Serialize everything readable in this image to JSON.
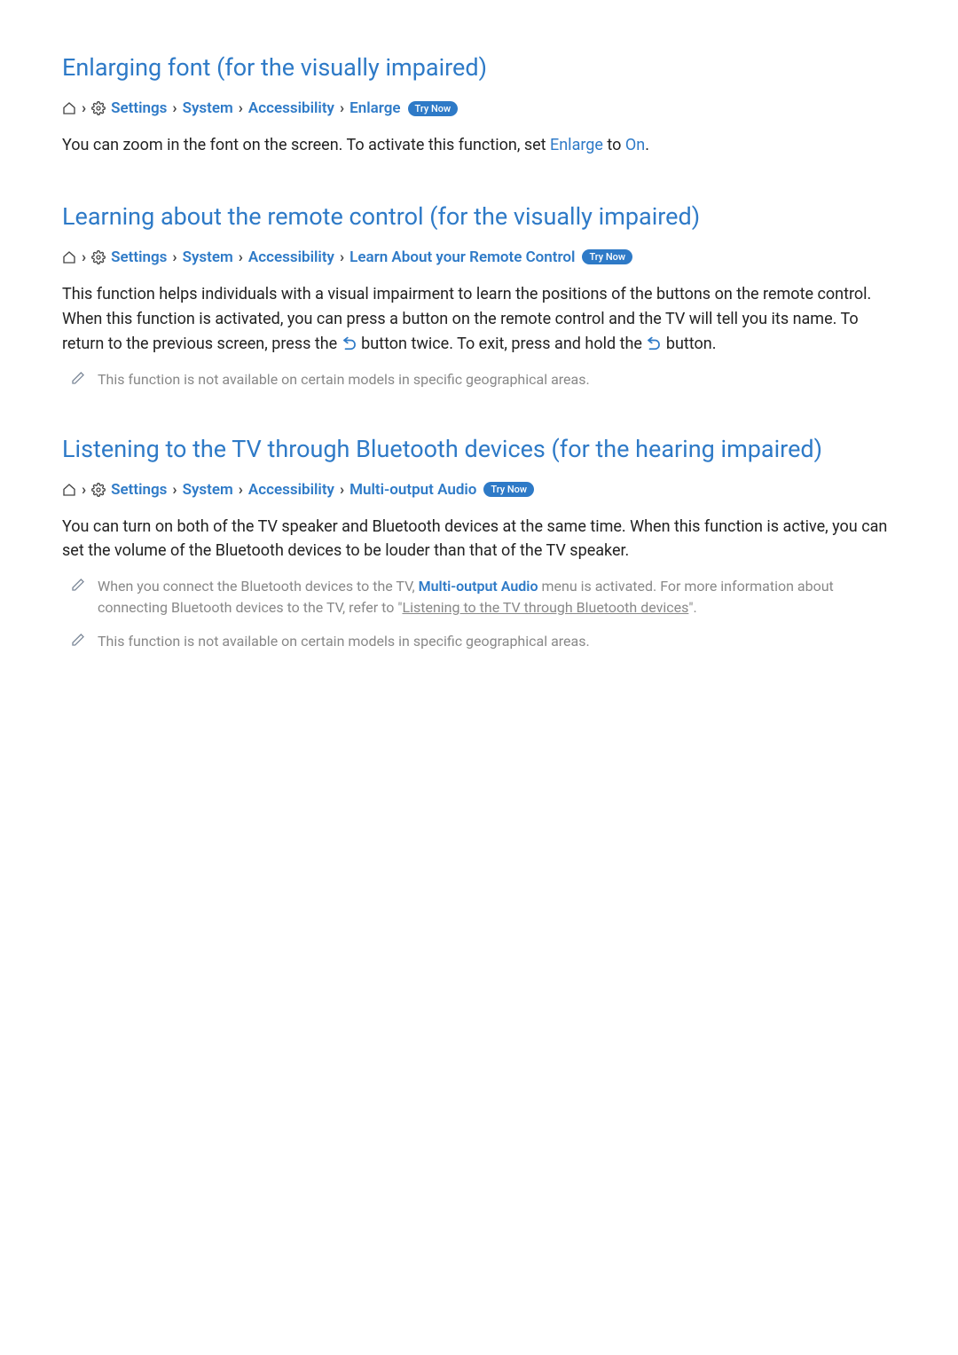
{
  "sections": [
    {
      "heading": "Enlarging font (for the visually impaired)",
      "breadcrumb": {
        "items": [
          "Settings",
          "System",
          "Accessibility",
          "Enlarge"
        ],
        "try_now": "Try Now"
      },
      "body_pre": "You can zoom in the font on the screen. To activate this function, set ",
      "body_link1": "Enlarge",
      "body_mid": " to ",
      "body_link2": "On",
      "body_post": "."
    },
    {
      "heading": "Learning about the remote control (for the visually impaired)",
      "breadcrumb": {
        "items": [
          "Settings",
          "System",
          "Accessibility",
          "Learn About your Remote Control"
        ],
        "try_now": "Try Now"
      },
      "body_pre": "This function helps individuals with a visual impairment to learn the positions of the buttons on the remote control. When this function is activated, you can press a button on the remote control and the TV will tell you its name. To return to the previous screen, press the ",
      "body_mid": " button twice. To exit, press and hold the ",
      "body_post": " button.",
      "note1": "This function is not available on certain models in specific geographical areas."
    },
    {
      "heading": "Listening to the TV through Bluetooth devices (for the hearing impaired)",
      "breadcrumb": {
        "items": [
          "Settings",
          "System",
          "Accessibility",
          "Multi-output Audio"
        ],
        "try_now": "Try Now"
      },
      "body": "You can turn on both of the TV speaker and Bluetooth devices at the same time. When this function is active, you can set the volume of the Bluetooth devices to be louder than that of the TV speaker.",
      "note1_pre": "When you connect the Bluetooth devices to the TV, ",
      "note1_link": "Multi-output Audio",
      "note1_mid": " menu is activated. For more information about connecting Bluetooth devices to the TV, refer to \"",
      "note1_underline": "Listening to the TV through Bluetooth devices",
      "note1_post": "\".",
      "note2": "This function is not available on certain models in specific geographical areas."
    }
  ]
}
